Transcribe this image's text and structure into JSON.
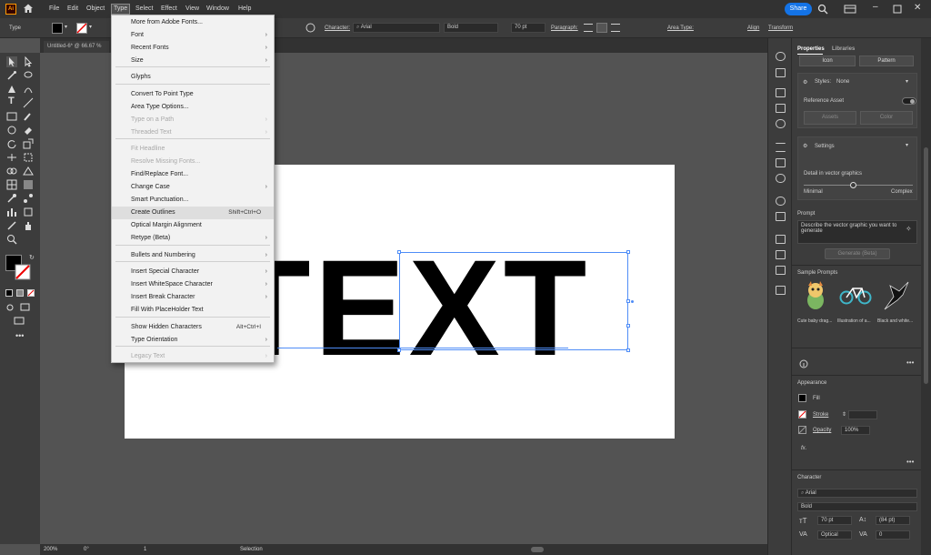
{
  "app": {
    "logo_text": "Ai"
  },
  "menubar": {
    "items": [
      "File",
      "Edit",
      "Object",
      "Type",
      "Select",
      "Effect",
      "View",
      "Window",
      "Help"
    ],
    "share_label": "Share"
  },
  "controlbar": {
    "tool_label": "Type",
    "character_label": "Character:",
    "font_family": "Arial",
    "font_style": "Bold",
    "font_size": "70 pt",
    "paragraph_label": "Paragraph:",
    "area_type_label": "Area Type:",
    "align_label": "Align",
    "transform_label": "Transform"
  },
  "doc_tab": {
    "title": "Untitled-6* @ 66.67 %"
  },
  "canvas": {
    "text": "TEXT"
  },
  "statusbar": {
    "zoom": "200%",
    "rotation": "0°",
    "artboard": "1",
    "tool": "Selection"
  },
  "type_menu": {
    "items": [
      {
        "label": "More from Adobe Fonts...",
        "disabled": false,
        "submenu": false
      },
      {
        "label": "Font",
        "disabled": false,
        "submenu": true
      },
      {
        "label": "Recent Fonts",
        "disabled": false,
        "submenu": true
      },
      {
        "label": "Size",
        "disabled": false,
        "submenu": true
      },
      {
        "label": "Glyphs",
        "disabled": false,
        "submenu": false
      },
      {
        "label": "Convert To Point Type",
        "disabled": false,
        "submenu": false
      },
      {
        "label": "Area Type Options...",
        "disabled": false,
        "submenu": false
      },
      {
        "label": "Type on a Path",
        "disabled": true,
        "submenu": true
      },
      {
        "label": "Threaded Text",
        "disabled": true,
        "submenu": true
      },
      {
        "label": "Fit Headline",
        "disabled": true,
        "submenu": false
      },
      {
        "label": "Resolve Missing Fonts...",
        "disabled": true,
        "submenu": false
      },
      {
        "label": "Find/Replace Font...",
        "disabled": false,
        "submenu": false
      },
      {
        "label": "Change Case",
        "disabled": false,
        "submenu": true
      },
      {
        "label": "Smart Punctuation...",
        "disabled": false,
        "submenu": false
      },
      {
        "label": "Create Outlines",
        "disabled": false,
        "submenu": false,
        "shortcut": "Shift+Ctrl+O",
        "hover": true
      },
      {
        "label": "Optical Margin Alignment",
        "disabled": false,
        "submenu": false
      },
      {
        "label": "Retype (Beta)",
        "disabled": false,
        "submenu": true
      },
      {
        "label": "Bullets and Numbering",
        "disabled": false,
        "submenu": true
      },
      {
        "label": "Insert Special Character",
        "disabled": false,
        "submenu": true
      },
      {
        "label": "Insert WhiteSpace Character",
        "disabled": false,
        "submenu": true
      },
      {
        "label": "Insert Break Character",
        "disabled": false,
        "submenu": true
      },
      {
        "label": "Fill With PlaceHolder Text",
        "disabled": false,
        "submenu": false
      },
      {
        "label": "Show Hidden Characters",
        "disabled": false,
        "submenu": false,
        "shortcut": "Alt+Ctrl+I"
      },
      {
        "label": "Type Orientation",
        "disabled": false,
        "submenu": true
      },
      {
        "label": "Legacy Text",
        "disabled": true,
        "submenu": true
      }
    ]
  },
  "right_panel": {
    "tabs": [
      "Properties",
      "Libraries"
    ],
    "top_buttons": [
      "Icon",
      "Pattern"
    ],
    "styles_label": "Styles:",
    "styles_value": "None",
    "reference_asset_label": "Reference Asset",
    "reference_buttons": [
      "Assets",
      "Color"
    ],
    "settings_label": "Settings",
    "detail_label": "Detail in vector graphics",
    "slider_min": "Minimal",
    "slider_max": "Complex",
    "slider_level": 0.45,
    "prompt_label": "Prompt",
    "prompt_text": "Describe the vector graphic you want to generate",
    "generate_button": "Generate (Beta)",
    "sample_prompts_label": "Sample Prompts",
    "samples": [
      "Cute baby drag...",
      "Illustration of a...",
      "Black and white..."
    ],
    "appearance_label": "Appearance",
    "fill_label": "Fill",
    "stroke_label": "Stroke",
    "opacity_label": "Opacity",
    "opacity_value": "100%",
    "fx_label": "fx.",
    "character_label": "Character",
    "font_family": "Arial",
    "font_style": "Bold",
    "font_size": "70 pt",
    "leading": "(84 pt)",
    "kerning": "Optical",
    "tracking": "0"
  },
  "colors": {
    "accent": "#1473e6",
    "selection": "#4f8df7",
    "ai_orange": "#ff9a00"
  }
}
